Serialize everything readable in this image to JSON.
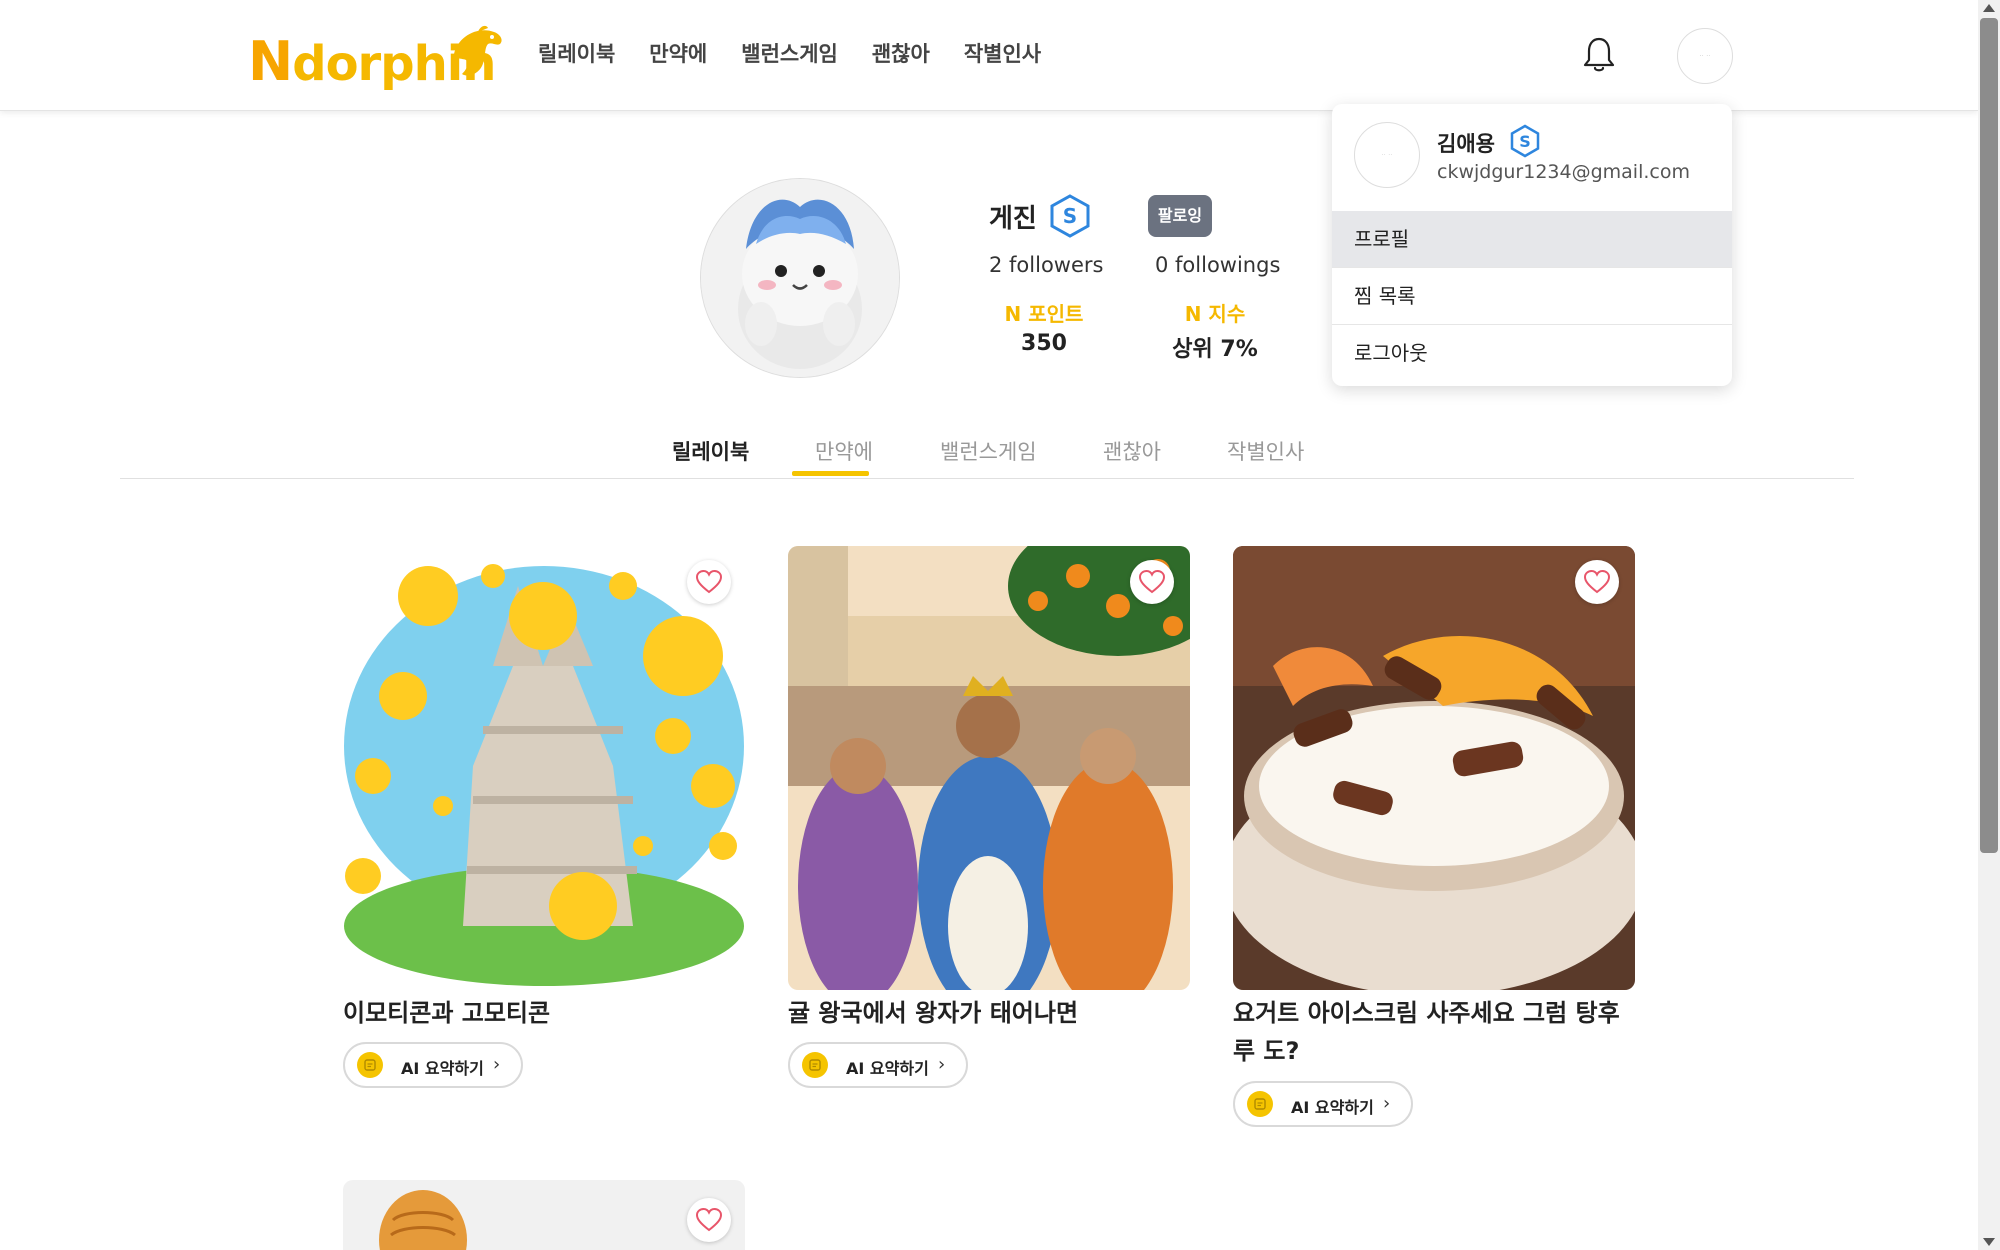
{
  "header": {
    "logo_text": "Ndorphin",
    "nav": [
      "릴레이북",
      "만약에",
      "밸런스게임",
      "괜찮아",
      "작별인사"
    ],
    "avatar_alt": "ᆢᆢ"
  },
  "dropdown": {
    "avatar_alt": "ᆢᆢ",
    "name": "김애용",
    "badge": "S",
    "email": "ckwjdgur1234@gmail.com",
    "items": [
      "프로필",
      "찜 목록",
      "로그아웃"
    ],
    "active_item": "프로필"
  },
  "profile": {
    "name": "게진",
    "badge": "S",
    "follow_label": "팔로잉",
    "followers": "2 followers",
    "followings": "0 followings",
    "point_label": "N 포인트",
    "point_value": "350",
    "index_label": "N 지수",
    "index_value": "상위 7%"
  },
  "tabs": {
    "items": [
      "릴레이북",
      "만약에",
      "밸런스게임",
      "괜찮아",
      "작별인사"
    ],
    "active": "릴레이북"
  },
  "cards": [
    {
      "title": "이모티콘과 고모티콘",
      "ai_label": "AI 요약하기",
      "liked": false
    },
    {
      "title": "귤 왕국에서 왕자가 태어나면",
      "ai_label": "AI 요약하기",
      "liked": false
    },
    {
      "title": "요거트 아이스크림 사주세요 그럼 탕후루 도?",
      "ai_label": "AI 요약하기",
      "liked": false
    },
    {
      "title": "",
      "ai_label": "",
      "liked": false
    }
  ],
  "colors": {
    "brand_yellow": "#F5B800",
    "tab_underline": "#F5C400",
    "badge_blue": "#2E86DE",
    "follow_button": "#6b7280",
    "heart": "#E8556A"
  }
}
